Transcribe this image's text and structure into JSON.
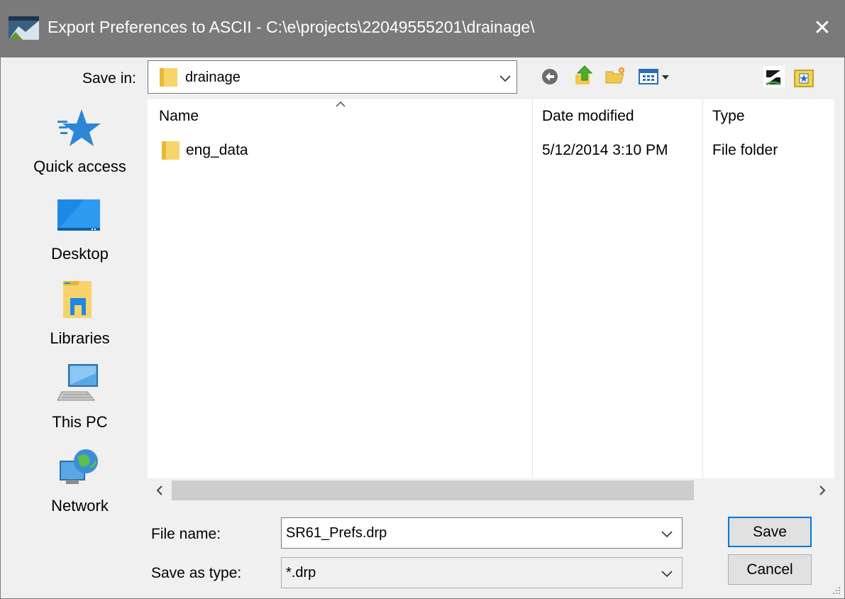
{
  "window": {
    "title": "Export Preferences to ASCII - C:\\e\\projects\\22049555201\\drainage\\",
    "close_label": "✕",
    "icon": "geopak-app-icon"
  },
  "toolbar": {
    "save_in_label": "Save in:",
    "save_in_value": "drainage",
    "icons": [
      "back-icon",
      "up-folder-icon",
      "new-folder-icon",
      "view-menu-icon",
      "app-logo-icon",
      "favorites-icon"
    ]
  },
  "places": [
    {
      "label": "Quick access",
      "icon": "quick-access-star-icon"
    },
    {
      "label": "Desktop",
      "icon": "desktop-icon"
    },
    {
      "label": "Libraries",
      "icon": "libraries-icon"
    },
    {
      "label": "This PC",
      "icon": "this-pc-icon"
    },
    {
      "label": "Network",
      "icon": "network-icon"
    }
  ],
  "file_list": {
    "columns": [
      "Name",
      "Date modified",
      "Type"
    ],
    "rows": [
      {
        "name": "eng_data",
        "date_modified": "5/12/2014 3:10 PM",
        "type": "File folder",
        "icon": "folder-icon"
      }
    ]
  },
  "scrollbar": {
    "left_arrow": "‹",
    "right_arrow": "›"
  },
  "form": {
    "file_name_label": "File name:",
    "file_name_value": "SR61_Prefs.drp",
    "save_as_type_label": "Save as type:",
    "save_as_type_value": "*.drp"
  },
  "buttons": {
    "save": "Save",
    "cancel": "Cancel"
  },
  "colors": {
    "title_bar": "#7a7a7a",
    "default_button_border": "#0078d7",
    "dialog_bg": "#f0f0f0"
  }
}
